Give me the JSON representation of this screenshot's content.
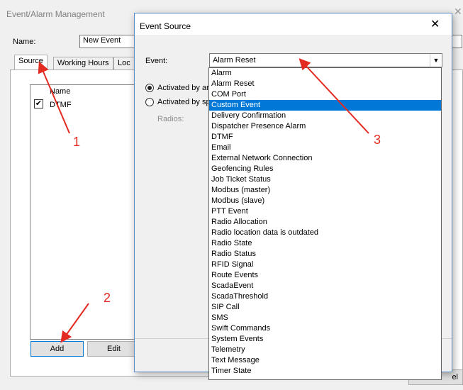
{
  "bg_window": {
    "title": "Event/Alarm Management",
    "close": "✕",
    "name_label": "Name:",
    "name_value": "New Event",
    "tabs": [
      "Source",
      "Working Hours",
      "Loc"
    ],
    "list_header": "Name",
    "list_items": [
      {
        "label": "DTMF",
        "checked": true
      }
    ],
    "add_label": "Add",
    "edit_label": "Edit",
    "cancel_label": "el"
  },
  "dialog": {
    "title": "Event Source",
    "close": "✕",
    "event_label": "Event:",
    "event_value": "Alarm Reset",
    "radio1_label": "Activated by ar",
    "radio2_label": "Activated by sp",
    "radios_label": "Radios:",
    "dropdown": {
      "selected_index": 3,
      "options": [
        "Alarm",
        "Alarm Reset",
        "COM Port",
        "Custom Event",
        "Delivery Confirmation",
        "Dispatcher Presence Alarm",
        "DTMF",
        "Email",
        "External Network Connection",
        "Geofencing Rules",
        "Job Ticket Status",
        "Modbus (master)",
        "Modbus (slave)",
        "PTT Event",
        "Radio Allocation",
        "Radio location data is outdated",
        "Radio State",
        "Radio Status",
        "RFID Signal",
        "Route Events",
        "ScadaEvent",
        "ScadaThreshold",
        "SIP Call",
        "SMS",
        "Swift Commands",
        "System Events",
        "Telemetry",
        "Text Message",
        "Timer State"
      ]
    }
  },
  "annotations": [
    "1",
    "2",
    "3"
  ],
  "colors": {
    "annotation": "#e32b22",
    "selection": "#0078d7"
  }
}
